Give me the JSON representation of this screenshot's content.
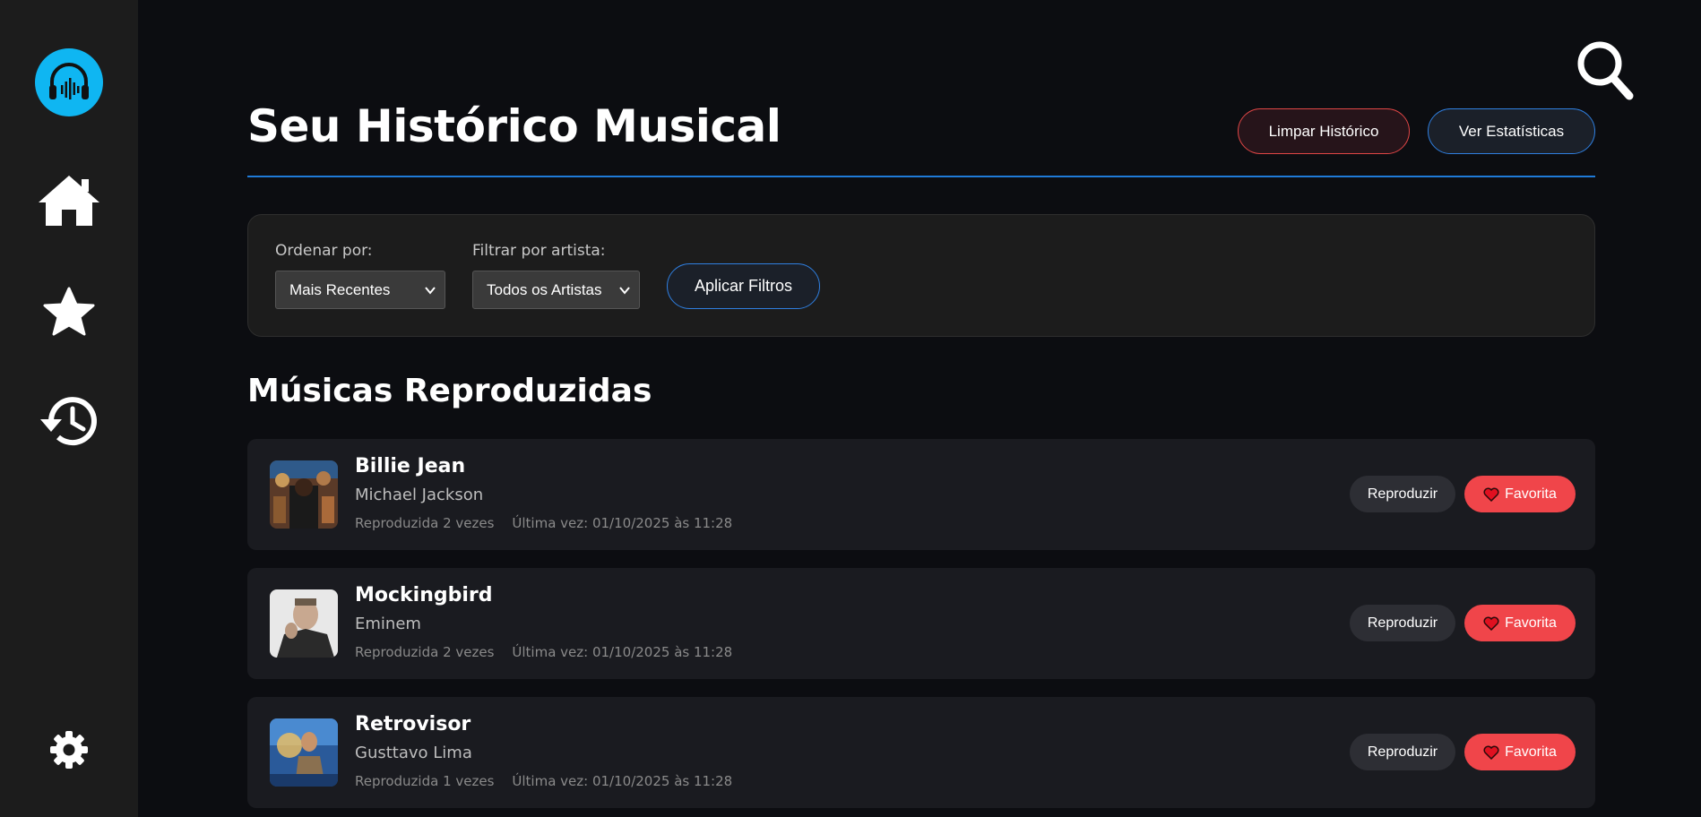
{
  "sidebar": {
    "logo_icon": "headphones-icon",
    "items": [
      {
        "icon": "home-icon"
      },
      {
        "icon": "star-icon"
      },
      {
        "icon": "history-icon"
      }
    ],
    "settings_icon": "gear-icon"
  },
  "header": {
    "search_icon": "search-icon",
    "title": "Seu Histórico Musical",
    "clear_label": "Limpar Histórico",
    "stats_label": "Ver Estatísticas"
  },
  "filters": {
    "order_label": "Ordenar por:",
    "order_value": "Mais Recentes",
    "artist_label": "Filtrar por artista:",
    "artist_value": "Todos os Artistas",
    "apply_label": "Aplicar Filtros"
  },
  "list": {
    "section_title": "Músicas Reproduzidas",
    "play_label": "Reproduzir",
    "fav_label": "Favorita",
    "songs": [
      {
        "title": "Billie Jean",
        "artist": "Michael Jackson",
        "plays": "Reproduzida 2 vezes",
        "last": "Última vez: 01/10/2025 às 11:28"
      },
      {
        "title": "Mockingbird",
        "artist": "Eminem",
        "plays": "Reproduzida 2 vezes",
        "last": "Última vez: 01/10/2025 às 11:28"
      },
      {
        "title": "Retrovisor",
        "artist": "Gusttavo Lima",
        "plays": "Reproduzida 1 vezes",
        "last": "Última vez: 01/10/2025 às 11:28"
      }
    ]
  },
  "colors": {
    "accent": "#0fb6f2",
    "blue_border": "#2f7fe0",
    "red": "#f0454a"
  }
}
